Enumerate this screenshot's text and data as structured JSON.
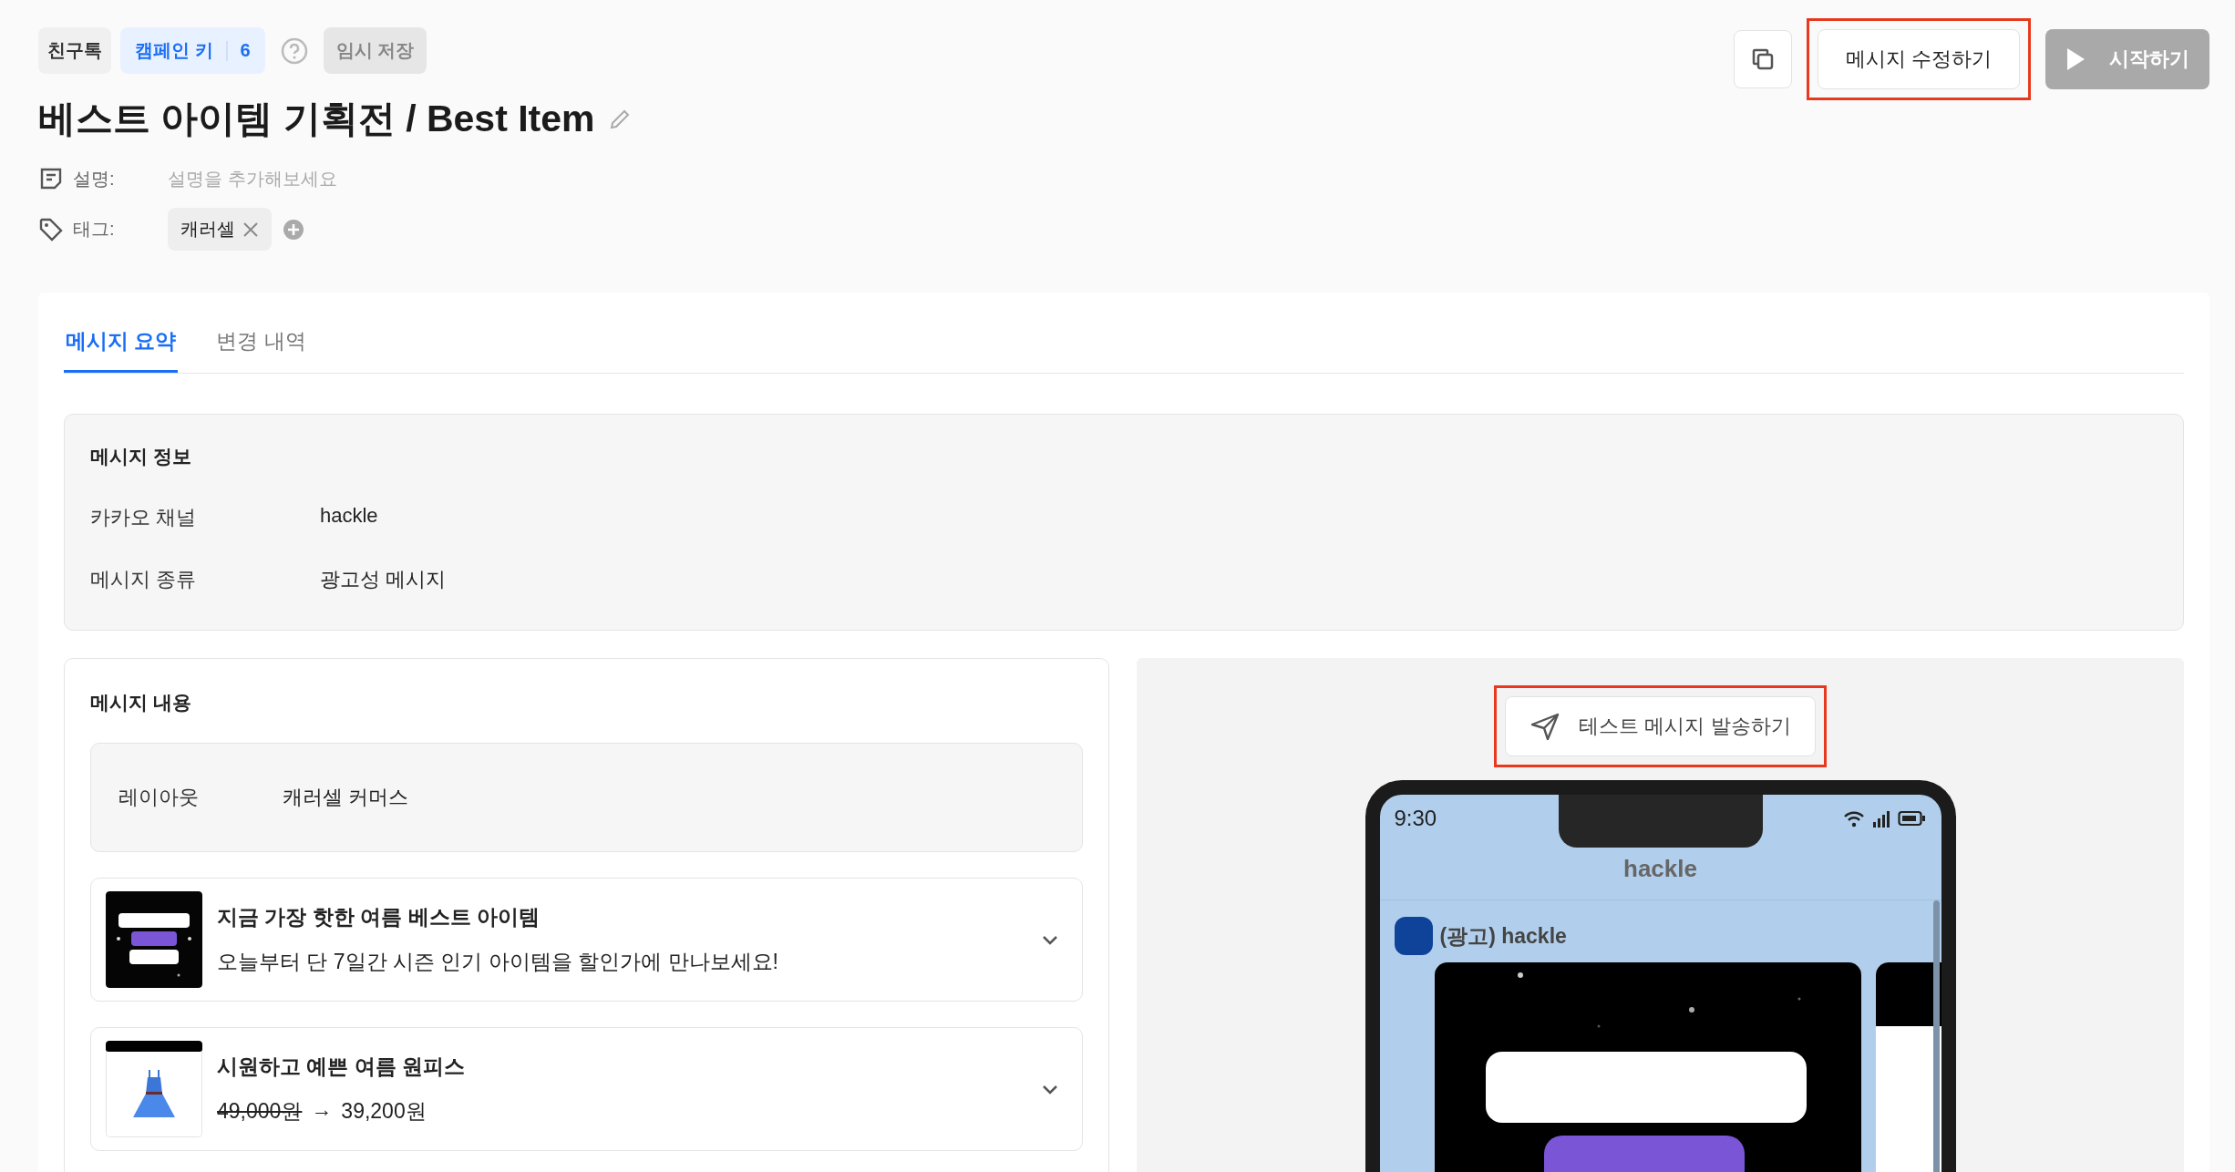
{
  "header": {
    "chips": [
      {
        "label": "친구톡",
        "kind": "plain"
      },
      {
        "label": "캠페인 키",
        "count": "6",
        "kind": "key"
      }
    ],
    "save_badge": "임시 저장",
    "title": "베스트 아이템 기획전 / Best Item",
    "description": {
      "label": "설명:",
      "placeholder": "설명을 추가해보세요"
    },
    "tags": {
      "label": "태그:",
      "items": [
        "캐러셀"
      ]
    }
  },
  "actions": [
    {
      "kind": "copy"
    },
    {
      "kind": "outline",
      "label": "메시지 수정하기",
      "highlighted": true
    },
    {
      "kind": "disabled",
      "label": "시작하기"
    }
  ],
  "tabs": [
    {
      "label": "메시지 요약",
      "selected": true
    },
    {
      "label": "변경 내역",
      "selected": false
    }
  ],
  "message_info": {
    "title": "메시지 정보",
    "rows": [
      {
        "label": "카카오 채널",
        "value": "hackle"
      },
      {
        "label": "메시지 종류",
        "value": "광고성 메시지"
      }
    ]
  },
  "message_content": {
    "title": "메시지 내용",
    "layout": {
      "label": "레이아웃",
      "value": "캐러셀 커머스"
    },
    "items": [
      {
        "kind": "text",
        "title": "지금 가장 핫한 여름 베스트 아이템",
        "text": "오늘부터 단 7일간 시즌 인기 아이템을 할인가에 만나보세요!",
        "expanded": false
      },
      {
        "kind": "price",
        "title": "시원하고 예쁜 여름 원피스",
        "original_price": "49,000원",
        "arrow": "→",
        "price": "39,200원",
        "expanded": false
      }
    ]
  },
  "preview": {
    "test_button": {
      "label": "테스트 메시지 발송하기",
      "highlighted": true
    },
    "phone": {
      "time": "9:30",
      "channel": "hackle",
      "sender": "(광고) hackle"
    }
  }
}
